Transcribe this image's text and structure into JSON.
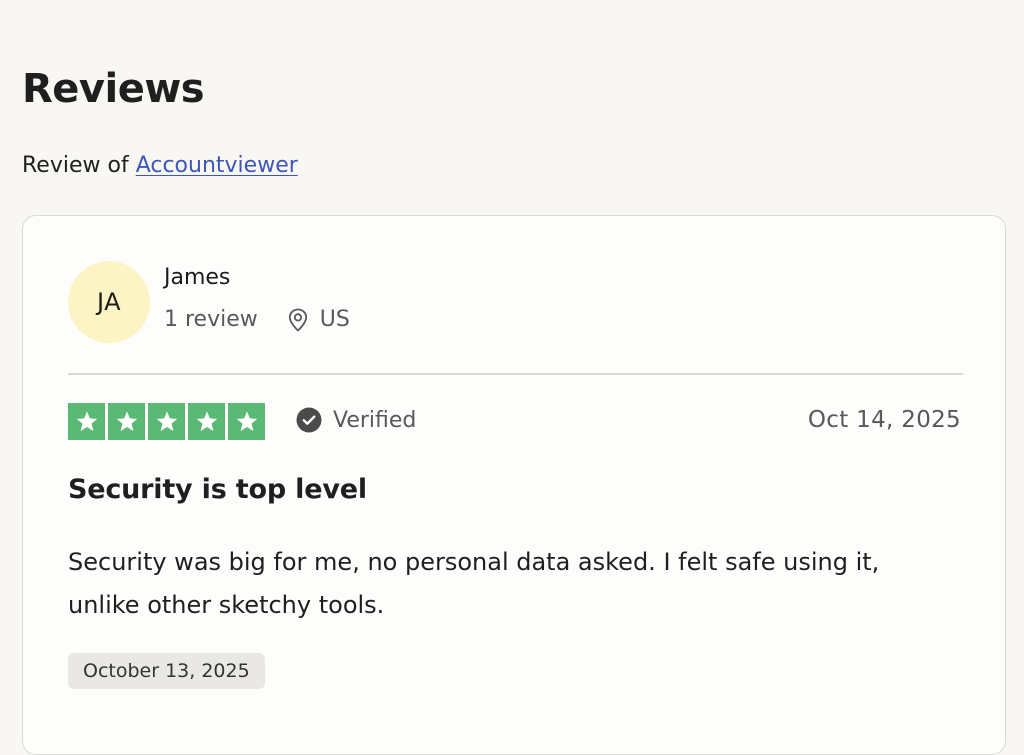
{
  "page": {
    "title": "Reviews",
    "review_of_prefix": "Review of",
    "company_link": "Accountviewer"
  },
  "reviewer": {
    "initials": "JA",
    "name": "James",
    "review_count": "1 review",
    "country": "US",
    "avatar_color": "#fcf4c4"
  },
  "review": {
    "rating": 5,
    "max_rating": 5,
    "star_color": "#5bb976",
    "verified_label": "Verified",
    "date": "Oct 14, 2025",
    "title": "Security is top level",
    "body": "Security was big for me, no personal data asked. I felt safe using it, unlike other sketchy tools.",
    "experience_date": "October 13, 2025"
  },
  "icons": {
    "location": "location-pin-icon",
    "verified": "check-circle-icon",
    "star": "star-icon"
  }
}
